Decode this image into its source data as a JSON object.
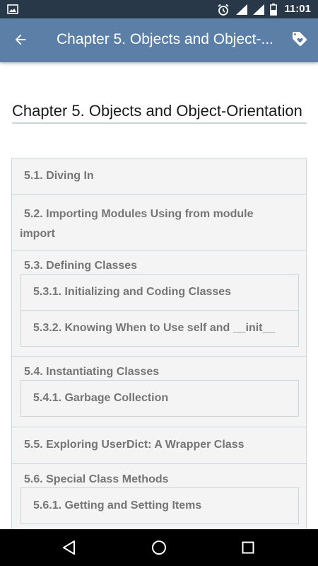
{
  "status": {
    "time": "11:01"
  },
  "appbar": {
    "title": "Chapter 5. Objects and Object-..."
  },
  "page": {
    "title": "Chapter 5. Objects and Object-Orientation"
  },
  "toc": [
    {
      "label": "5.1. Diving In"
    },
    {
      "label": "5.2. Importing Modules Using from module import"
    },
    {
      "label": "5.3. Defining Classes",
      "children": [
        "5.3.1. Initializing and Coding Classes",
        "5.3.2. Knowing When to Use self and __init__"
      ]
    },
    {
      "label": "5.4. Instantiating Classes",
      "children": [
        "5.4.1. Garbage Collection"
      ]
    },
    {
      "label": "5.5. Exploring UserDict: A Wrapper Class"
    },
    {
      "label": "5.6. Special Class Methods",
      "children": [
        "5.6.1. Getting and Setting Items"
      ]
    }
  ]
}
